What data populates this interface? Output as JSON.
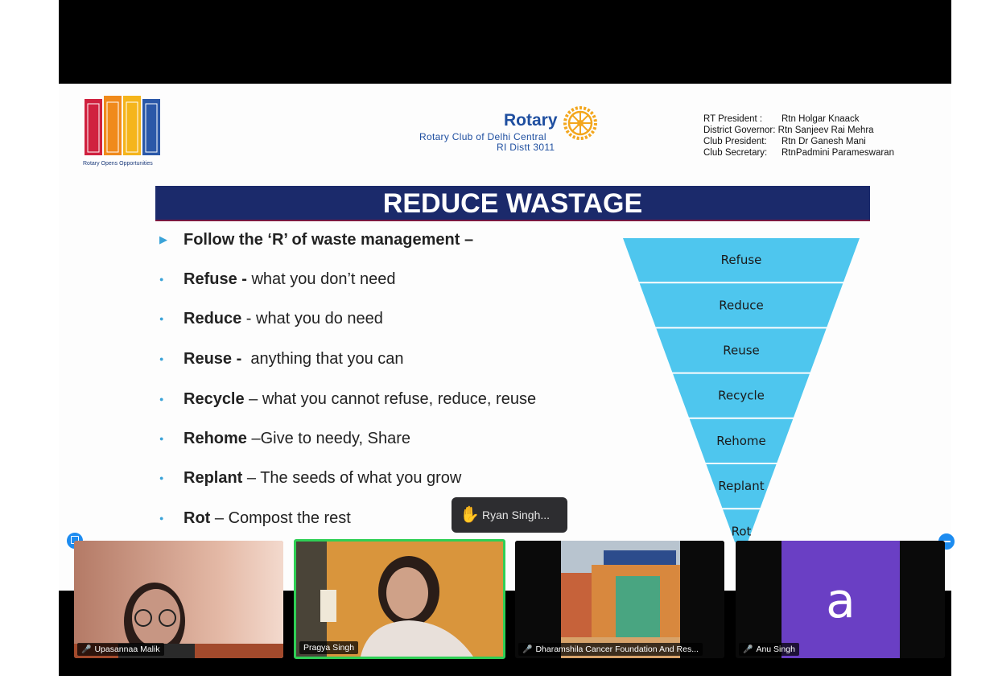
{
  "slide": {
    "logo_tagline": "Rotary Opens Opportunities",
    "rotary": {
      "name": "Rotary",
      "club": "Rotary Club of Delhi Central",
      "district": "RI Distt 3011"
    },
    "officers": [
      {
        "role": "RT President :",
        "name": "Rtn Holgar Knaack"
      },
      {
        "role": "District Governor:",
        "name": "Rtn Sanjeev Rai Mehra"
      },
      {
        "role": "Club President:",
        "name": "Rtn Dr Ganesh Mani"
      },
      {
        "role": "Club Secretary:",
        "name": "RtnPadmini Parameswaran"
      }
    ],
    "title": "REDUCE WASTAGE",
    "bullets": [
      {
        "bold": "Follow the ‘R’ of waste management –",
        "rest": ""
      },
      {
        "bold": "Refuse -",
        "rest": " what you don’t need"
      },
      {
        "bold": "Reduce",
        "rest": " - what you do need"
      },
      {
        "bold": "Reuse -",
        "rest": "  anything that you can"
      },
      {
        "bold": "Recycle",
        "rest": " – what you cannot refuse, reduce, reuse"
      },
      {
        "bold": "Rehome",
        "rest": " –Give to needy, Share"
      },
      {
        "bold": "Replant",
        "rest": " – The seeds of what you grow"
      },
      {
        "bold": "Rot",
        "rest": " – Compost the rest"
      }
    ],
    "pyramid": [
      "Refuse",
      "Reduce",
      "Reuse",
      "Recycle",
      "Rehome",
      "Replant",
      "Rot"
    ],
    "pyramid_color": "#4ec6ee"
  },
  "raise_hand": {
    "name": "Ryan Singh..."
  },
  "participants": [
    {
      "name": "Upasannaa Malik",
      "muted": true
    },
    {
      "name": "Pragya Singh",
      "muted": false,
      "active_speaker": true
    },
    {
      "name": "Dharamshila Cancer Foundation And Res...",
      "muted": true
    },
    {
      "name": "Anu Singh",
      "muted": true,
      "avatar_letter": "a",
      "avatar_color": "#6a3fc4"
    }
  ]
}
